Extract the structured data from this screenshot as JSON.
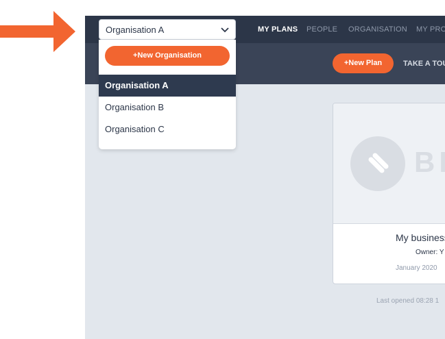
{
  "org_selector": {
    "current": "Organisation A"
  },
  "nav": [
    {
      "label": "MY PLANS",
      "active": true
    },
    {
      "label": "PEOPLE",
      "active": false
    },
    {
      "label": "ORGANISATION",
      "active": false
    },
    {
      "label": "MY PROF",
      "active": false
    }
  ],
  "toolbar": {
    "new_plan_label": "+New Plan",
    "tour_label": "TAKE A TOUR"
  },
  "dropdown": {
    "new_org_label": "+New Organisation",
    "items": [
      {
        "label": "Organisation A",
        "selected": true
      },
      {
        "label": "Organisation B",
        "selected": false
      },
      {
        "label": "Organisation C",
        "selected": false
      }
    ]
  },
  "plan_card": {
    "logo_text": "BR",
    "title": "My business",
    "owner": "Owner: Y",
    "date": "January 2020",
    "last_opened": "Last opened 08:28 1"
  },
  "colors": {
    "accent": "#f26530",
    "topbar": "#2c3648",
    "subbar": "#3a4457",
    "background": "#e2e7ed"
  },
  "icons": {
    "arrow": "arrow-right-icon",
    "chevron": "chevron-down-icon",
    "logo": "brand-logo-icon"
  }
}
